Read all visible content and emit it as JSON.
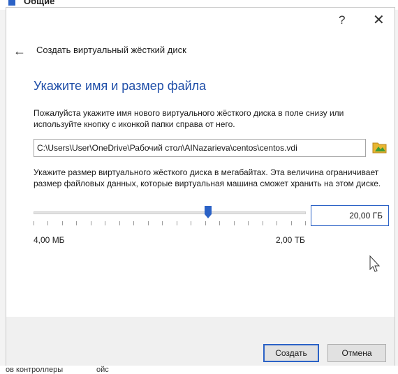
{
  "background": {
    "top_label": "Общие",
    "bottom_label_left": "ов контроллеры",
    "bottom_label_right": "ойс"
  },
  "titlebar": {
    "help_glyph": "?",
    "close_glyph": "✕"
  },
  "wizard": {
    "back_glyph": "←",
    "title": "Создать виртуальный жёсткий диск"
  },
  "section": {
    "title": "Укажите имя и размер файла",
    "description": "Пожалуйста укажите имя нового виртуального жёсткого диска в поле снизу или используйте кнопку с иконкой папки справа от него."
  },
  "file_path": {
    "value": "C:\\Users\\User\\OneDrive\\Рабочий стол\\AINazarieva\\centos\\centos.vdi"
  },
  "size": {
    "description": "Укажите размер виртуального жёсткого диска в мегабайтах. Эта величина ограничивает размер файловых данных, которые виртуальная машина сможет хранить на этом диске.",
    "value": "20,00 ГБ",
    "slider_min_label": "4,00 МБ",
    "slider_max_label": "2,00 ТБ",
    "slider_position_fraction": 0.64,
    "tick_count": 20
  },
  "buttons": {
    "create": "Создать",
    "cancel": "Отмена"
  },
  "colors": {
    "accent": "#2b62c6",
    "title_blue": "#1f4ea8",
    "folder_yellow": "#e8b631",
    "folder_green": "#3f9c35"
  }
}
